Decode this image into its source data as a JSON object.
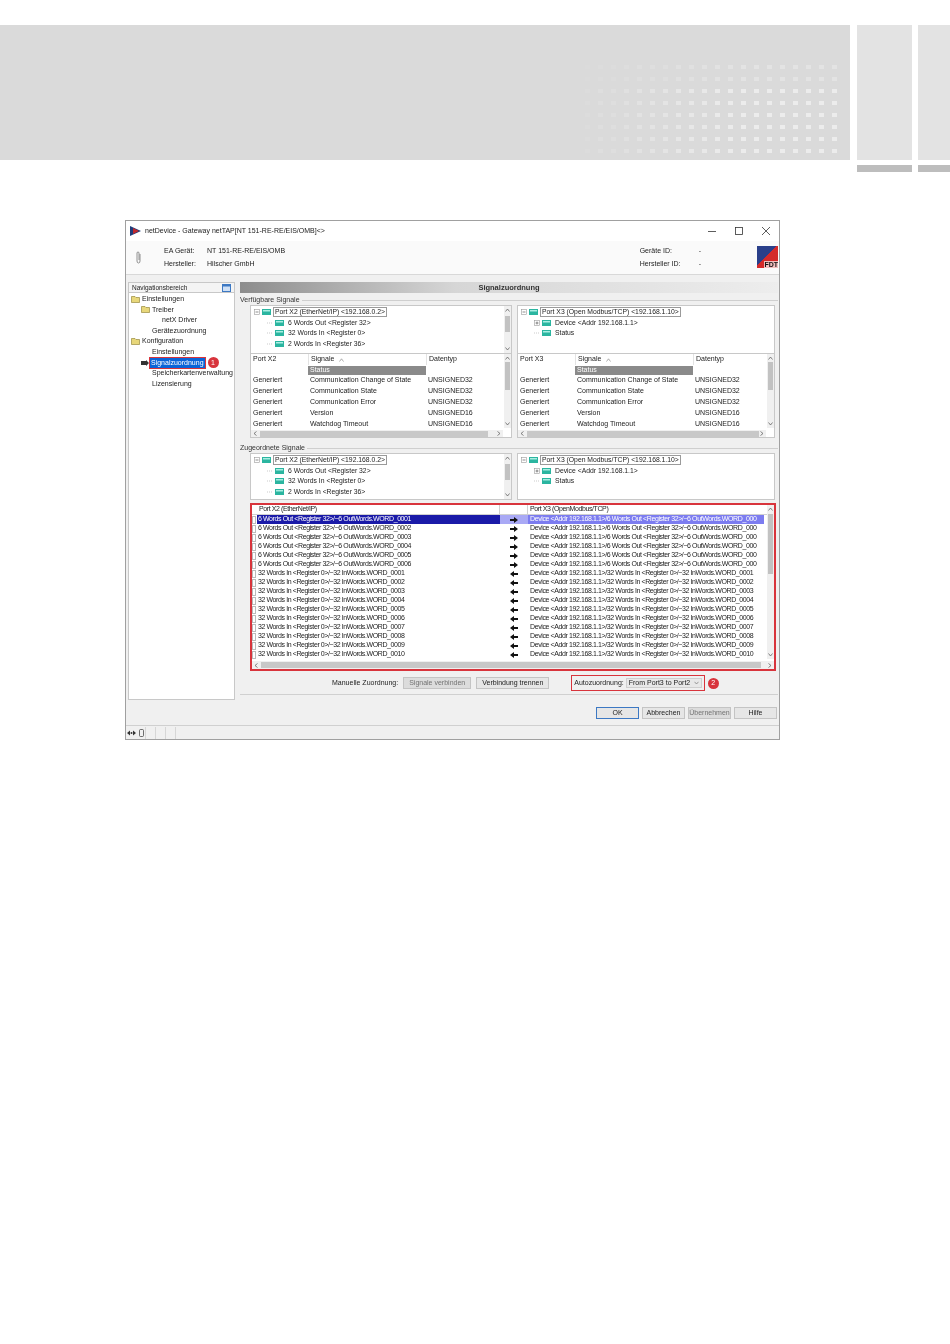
{
  "window": {
    "title": "netDevice - Gateway netTAP[NT 151-RE-RE/EIS/OMB]<>"
  },
  "device_info": [
    {
      "label": "EA Gerät:",
      "value": "NT 151-RE-RE/EIS/OMB"
    },
    {
      "label": "Hersteller:",
      "value": "Hilscher GmbH"
    }
  ],
  "device_ids": [
    {
      "label": "Geräte ID:",
      "value": "-"
    },
    {
      "label": "Hersteller ID:",
      "value": "-"
    }
  ],
  "logo_text": "FDT",
  "navigation": {
    "title": "Navigationsbereich",
    "items": [
      {
        "label": "Einstellungen",
        "selected": false,
        "children": [
          {
            "label": "Treiber",
            "selected": false,
            "children": [
              {
                "label": "netX Driver",
                "selected": false
              }
            ]
          },
          {
            "label": "Gerätezuordnung",
            "selected": false
          }
        ]
      },
      {
        "label": "Konfiguration",
        "selected": false,
        "children": [
          {
            "label": "Einstellungen",
            "selected": false
          },
          {
            "label": "Signalzuordnung",
            "selected": true,
            "callout": "1"
          },
          {
            "label": "Speicherkartenverwaltung",
            "selected": false
          },
          {
            "label": "Lizensierung",
            "selected": false
          }
        ]
      }
    ]
  },
  "page_title": "Signalzuordnung",
  "available_signals": {
    "label": "Verfügbare Signale",
    "panels": [
      {
        "tree": {
          "label": "Port X2 (EtherNet/IP) <192.168.0.2>",
          "selected": true,
          "expanded": true,
          "children": [
            {
              "label": "6 Words Out <Register 32>",
              "selected": false
            },
            {
              "label": "32 Words In <Register 0>",
              "selected": false
            },
            {
              "label": "2 Words In <Register 36>",
              "selected": false
            }
          ]
        },
        "table": {
          "columns": [
            {
              "label": "Port X2",
              "sorted": false
            },
            {
              "label": "Signale",
              "sorted": true
            },
            {
              "label": "Datentyp",
              "sorted": false
            }
          ],
          "filter": "Status",
          "rows": [
            {
              "port": "Generiert",
              "signal": "Communication Change of State",
              "type": "UNSIGNED32"
            },
            {
              "port": "Generiert",
              "signal": "Communication State",
              "type": "UNSIGNED32"
            },
            {
              "port": "Generiert",
              "signal": "Communication Error",
              "type": "UNSIGNED32"
            },
            {
              "port": "Generiert",
              "signal": "Version",
              "type": "UNSIGNED16"
            },
            {
              "port": "Generiert",
              "signal": "Watchdog Timeout",
              "type": "UNSIGNED16"
            }
          ]
        }
      },
      {
        "tree": {
          "label": "Port X3 (Open Modbus/TCP) <192.168.1.10>",
          "selected": true,
          "expanded": true,
          "children": [
            {
              "label": "Device <Addr 192.168.1.1>",
              "selected": false,
              "expanded": false
            },
            {
              "label": "Status",
              "selected": false
            }
          ]
        },
        "table": {
          "columns": [
            {
              "label": "Port X3",
              "sorted": false
            },
            {
              "label": "Signale",
              "sorted": true
            },
            {
              "label": "Datentyp",
              "sorted": false
            }
          ],
          "filter": "Status",
          "rows": [
            {
              "port": "Generiert",
              "signal": "Communication Change of State",
              "type": "UNSIGNED32"
            },
            {
              "port": "Generiert",
              "signal": "Communication State",
              "type": "UNSIGNED32"
            },
            {
              "port": "Generiert",
              "signal": "Communication Error",
              "type": "UNSIGNED32"
            },
            {
              "port": "Generiert",
              "signal": "Version",
              "type": "UNSIGNED16"
            },
            {
              "port": "Generiert",
              "signal": "Watchdog Timeout",
              "type": "UNSIGNED16"
            }
          ]
        }
      }
    ]
  },
  "assigned_signals": {
    "label": "Zugeordnete Signale",
    "trees": [
      {
        "label": "Port X2 (EtherNet/IP) <192.168.0.2>",
        "selected": true,
        "expanded": true,
        "children": [
          {
            "label": "6 Words Out <Register 32>",
            "selected": false
          },
          {
            "label": "32 Words In <Register 0>",
            "selected": false
          },
          {
            "label": "2 Words In <Register 36>",
            "selected": false
          }
        ]
      },
      {
        "label": "Port X3 (Open Modbus/TCP) <192.168.1.10>",
        "selected": true,
        "expanded": true,
        "children": [
          {
            "label": "Device <Addr 192.168.1.1>",
            "selected": false,
            "expanded": false
          },
          {
            "label": "Status",
            "selected": false
          }
        ]
      }
    ],
    "mapping": {
      "columns": [
        "Port X2 (EtherNet/IP)",
        "Port X3 (OpenModbus/TCP)"
      ],
      "rows": [
        {
          "port_x2": "6 Words Out <Register 32>/~6 OutWords.WORD_0001",
          "kind": "output",
          "port_x3": "Device <Addr 192.168.1.1>/6 Words Out <Register 32>/~6 OutWords.WORD_000",
          "selected": true
        },
        {
          "port_x2": "6 Words Out <Register 32>/~6 OutWords.WORD_0002",
          "kind": "output",
          "port_x3": "Device <Addr 192.168.1.1>/6 Words Out <Register 32>/~6 OutWords.WORD_000",
          "selected": false
        },
        {
          "port_x2": "6 Words Out <Register 32>/~6 OutWords.WORD_0003",
          "kind": "output",
          "port_x3": "Device <Addr 192.168.1.1>/6 Words Out <Register 32>/~6 OutWords.WORD_000",
          "selected": false
        },
        {
          "port_x2": "6 Words Out <Register 32>/~6 OutWords.WORD_0004",
          "kind": "output",
          "port_x3": "Device <Addr 192.168.1.1>/6 Words Out <Register 32>/~6 OutWords.WORD_000",
          "selected": false
        },
        {
          "port_x2": "6 Words Out <Register 32>/~6 OutWords.WORD_0005",
          "kind": "output",
          "port_x3": "Device <Addr 192.168.1.1>/6 Words Out <Register 32>/~6 OutWords.WORD_000",
          "selected": false
        },
        {
          "port_x2": "6 Words Out <Register 32>/~6 OutWords.WORD_0006",
          "kind": "output",
          "port_x3": "Device <Addr 192.168.1.1>/6 Words Out <Register 32>/~6 OutWords.WORD_000",
          "selected": false
        },
        {
          "port_x2": "32 Words In <Register 0>/~32 InWords.WORD_0001",
          "kind": "input",
          "port_x3": "Device <Addr 192.168.1.1>/32 Words In <Register 0>/~32 InWords.WORD_0001",
          "selected": false
        },
        {
          "port_x2": "32 Words In <Register 0>/~32 InWords.WORD_0002",
          "kind": "input",
          "port_x3": "Device <Addr 192.168.1.1>/32 Words In <Register 0>/~32 InWords.WORD_0002",
          "selected": false
        },
        {
          "port_x2": "32 Words In <Register 0>/~32 InWords.WORD_0003",
          "kind": "input",
          "port_x3": "Device <Addr 192.168.1.1>/32 Words In <Register 0>/~32 InWords.WORD_0003",
          "selected": false
        },
        {
          "port_x2": "32 Words In <Register 0>/~32 InWords.WORD_0004",
          "kind": "input",
          "port_x3": "Device <Addr 192.168.1.1>/32 Words In <Register 0>/~32 InWords.WORD_0004",
          "selected": false
        },
        {
          "port_x2": "32 Words In <Register 0>/~32 InWords.WORD_0005",
          "kind": "input",
          "port_x3": "Device <Addr 192.168.1.1>/32 Words In <Register 0>/~32 InWords.WORD_0005",
          "selected": false
        },
        {
          "port_x2": "32 Words In <Register 0>/~32 InWords.WORD_0006",
          "kind": "input",
          "port_x3": "Device <Addr 192.168.1.1>/32 Words In <Register 0>/~32 InWords.WORD_0006",
          "selected": false
        },
        {
          "port_x2": "32 Words In <Register 0>/~32 InWords.WORD_0007",
          "kind": "input",
          "port_x3": "Device <Addr 192.168.1.1>/32 Words In <Register 0>/~32 InWords.WORD_0007",
          "selected": false
        },
        {
          "port_x2": "32 Words In <Register 0>/~32 InWords.WORD_0008",
          "kind": "input",
          "port_x3": "Device <Addr 192.168.1.1>/32 Words In <Register 0>/~32 InWords.WORD_0008",
          "selected": false
        },
        {
          "port_x2": "32 Words In <Register 0>/~32 InWords.WORD_0009",
          "kind": "input",
          "port_x3": "Device <Addr 192.168.1.1>/32 Words In <Register 0>/~32 InWords.WORD_0009",
          "selected": false
        },
        {
          "port_x2": "32 Words In <Register 0>/~32 InWords.WORD_0010",
          "kind": "input",
          "port_x3": "Device <Addr 192.168.1.1>/32 Words In <Register 0>/~32 InWords.WORD_0010",
          "selected": false
        }
      ]
    }
  },
  "manual_assignment": {
    "label": "Manuelle Zuordnung:",
    "buttons": [
      {
        "label": "Signale verbinden",
        "disabled": true
      },
      {
        "label": "Verbindung trennen",
        "disabled": false
      }
    ]
  },
  "auto_assignment": {
    "label": "Autozuordnung:",
    "value": "From Port3 to Port2",
    "callout": "2"
  },
  "dialog_buttons": [
    {
      "label": "OK",
      "disabled": false,
      "default": true
    },
    {
      "label": "Abbrechen",
      "disabled": false,
      "default": false
    },
    {
      "label": "Übernehmen",
      "disabled": true,
      "default": false
    },
    {
      "label": "Hilfe",
      "disabled": false,
      "default": false
    }
  ]
}
